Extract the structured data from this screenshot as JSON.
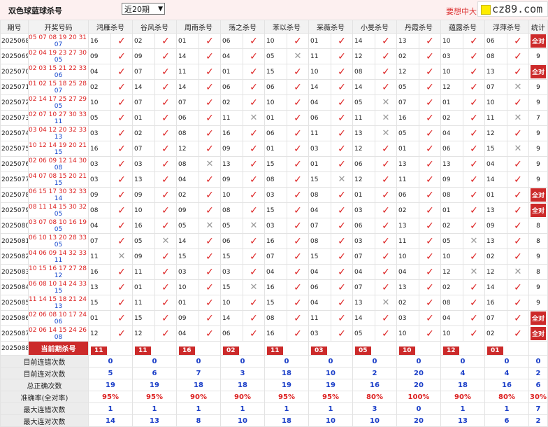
{
  "header": {
    "title": "双色球蓝球杀号",
    "range_select": "近20期",
    "promo": "要想中大",
    "logo": "cz89.com"
  },
  "columns": [
    "期号",
    "开奖号码",
    "鸿雁杀号",
    "谷风杀号",
    "周南杀号",
    "荡之杀号",
    "苯以杀号",
    "采薇杀号",
    "小旻杀号",
    "丹霞杀号",
    "蕴露杀号",
    "浮萍杀号",
    "统计"
  ],
  "rows": [
    {
      "p": "2025068",
      "red": "05 07 08 19 20 31 +",
      "blue": "07",
      "k": [
        [
          "16",
          1
        ],
        [
          "02",
          1
        ],
        [
          "01",
          1
        ],
        [
          "06",
          1
        ],
        [
          "10",
          1
        ],
        [
          "01",
          1
        ],
        [
          "14",
          1
        ],
        [
          "13",
          1
        ],
        [
          "10",
          1
        ],
        [
          "06",
          1
        ]
      ],
      "s": "全对"
    },
    {
      "p": "2025069",
      "red": "02 04 19 23 27 30 +",
      "blue": "05",
      "k": [
        [
          "09",
          1
        ],
        [
          "09",
          1
        ],
        [
          "14",
          1
        ],
        [
          "04",
          1
        ],
        [
          "05",
          0
        ],
        [
          "11",
          1
        ],
        [
          "12",
          1
        ],
        [
          "02",
          1
        ],
        [
          "03",
          1
        ],
        [
          "08",
          1
        ]
      ],
      "s": "9"
    },
    {
      "p": "2025070",
      "red": "02 03 15 21 22 33 +",
      "blue": "06",
      "k": [
        [
          "04",
          1
        ],
        [
          "07",
          1
        ],
        [
          "11",
          1
        ],
        [
          "01",
          1
        ],
        [
          "15",
          1
        ],
        [
          "10",
          1
        ],
        [
          "08",
          1
        ],
        [
          "12",
          1
        ],
        [
          "10",
          1
        ],
        [
          "13",
          1
        ]
      ],
      "s": "全对"
    },
    {
      "p": "2025071",
      "red": "01 02 15 18 25 28 +",
      "blue": "07",
      "k": [
        [
          "02",
          1
        ],
        [
          "14",
          1
        ],
        [
          "14",
          1
        ],
        [
          "06",
          1
        ],
        [
          "06",
          1
        ],
        [
          "14",
          1
        ],
        [
          "14",
          1
        ],
        [
          "05",
          1
        ],
        [
          "12",
          1
        ],
        [
          "07",
          0
        ]
      ],
      "s": "9"
    },
    {
      "p": "2025072",
      "red": "02 14 17 25 27 29 +",
      "blue": "05",
      "k": [
        [
          "10",
          1
        ],
        [
          "07",
          1
        ],
        [
          "07",
          1
        ],
        [
          "02",
          1
        ],
        [
          "10",
          1
        ],
        [
          "04",
          1
        ],
        [
          "05",
          0
        ],
        [
          "07",
          1
        ],
        [
          "01",
          1
        ],
        [
          "10",
          1
        ]
      ],
      "s": "9"
    },
    {
      "p": "2025073",
      "red": "02 07 10 27 30 33 +",
      "blue": "11",
      "k": [
        [
          "05",
          1
        ],
        [
          "01",
          1
        ],
        [
          "06",
          1
        ],
        [
          "11",
          0
        ],
        [
          "01",
          1
        ],
        [
          "06",
          1
        ],
        [
          "11",
          0
        ],
        [
          "16",
          1
        ],
        [
          "02",
          1
        ],
        [
          "11",
          0
        ]
      ],
      "s": "7"
    },
    {
      "p": "2025074",
      "red": "03 04 12 20 32 33 +",
      "blue": "13",
      "k": [
        [
          "03",
          1
        ],
        [
          "02",
          1
        ],
        [
          "08",
          1
        ],
        [
          "16",
          1
        ],
        [
          "06",
          1
        ],
        [
          "11",
          1
        ],
        [
          "13",
          0
        ],
        [
          "05",
          1
        ],
        [
          "04",
          1
        ],
        [
          "12",
          1
        ]
      ],
      "s": "9"
    },
    {
      "p": "2025075",
      "red": "10 12 14 19 20 21 +",
      "blue": "15",
      "k": [
        [
          "16",
          1
        ],
        [
          "07",
          1
        ],
        [
          "12",
          1
        ],
        [
          "09",
          1
        ],
        [
          "01",
          1
        ],
        [
          "03",
          1
        ],
        [
          "12",
          1
        ],
        [
          "01",
          1
        ],
        [
          "06",
          1
        ],
        [
          "15",
          0
        ]
      ],
      "s": "9"
    },
    {
      "p": "2025076",
      "red": "02 06 09 12 14 30 +",
      "blue": "08",
      "k": [
        [
          "03",
          1
        ],
        [
          "03",
          1
        ],
        [
          "08",
          0
        ],
        [
          "13",
          1
        ],
        [
          "15",
          1
        ],
        [
          "01",
          1
        ],
        [
          "06",
          1
        ],
        [
          "13",
          1
        ],
        [
          "13",
          1
        ],
        [
          "04",
          1
        ]
      ],
      "s": "9"
    },
    {
      "p": "2025077",
      "red": "04 07 08 15 20 21 +",
      "blue": "15",
      "k": [
        [
          "03",
          1
        ],
        [
          "13",
          1
        ],
        [
          "04",
          1
        ],
        [
          "09",
          1
        ],
        [
          "08",
          1
        ],
        [
          "15",
          0
        ],
        [
          "12",
          1
        ],
        [
          "11",
          1
        ],
        [
          "09",
          1
        ],
        [
          "14",
          1
        ]
      ],
      "s": "9"
    },
    {
      "p": "2025078",
      "red": "06 15 17 30 32 33 +",
      "blue": "14",
      "k": [
        [
          "09",
          1
        ],
        [
          "09",
          1
        ],
        [
          "02",
          1
        ],
        [
          "10",
          1
        ],
        [
          "03",
          1
        ],
        [
          "08",
          1
        ],
        [
          "01",
          1
        ],
        [
          "06",
          1
        ],
        [
          "08",
          1
        ],
        [
          "01",
          1
        ]
      ],
      "s": "全对"
    },
    {
      "p": "2025079",
      "red": "08 11 14 15 30 32 +",
      "blue": "05",
      "k": [
        [
          "08",
          1
        ],
        [
          "10",
          1
        ],
        [
          "09",
          1
        ],
        [
          "08",
          1
        ],
        [
          "15",
          1
        ],
        [
          "04",
          1
        ],
        [
          "03",
          1
        ],
        [
          "02",
          1
        ],
        [
          "01",
          1
        ],
        [
          "13",
          1
        ]
      ],
      "s": "全对"
    },
    {
      "p": "2025080",
      "red": "03 07 08 10 16 19 +",
      "blue": "05",
      "k": [
        [
          "04",
          1
        ],
        [
          "16",
          1
        ],
        [
          "05",
          0
        ],
        [
          "05",
          0
        ],
        [
          "03",
          1
        ],
        [
          "07",
          1
        ],
        [
          "06",
          1
        ],
        [
          "13",
          1
        ],
        [
          "02",
          1
        ],
        [
          "09",
          1
        ]
      ],
      "s": "8"
    },
    {
      "p": "2025081",
      "red": "06 10 13 20 28 33 +",
      "blue": "05",
      "k": [
        [
          "07",
          1
        ],
        [
          "05",
          0
        ],
        [
          "14",
          1
        ],
        [
          "06",
          1
        ],
        [
          "16",
          1
        ],
        [
          "08",
          1
        ],
        [
          "03",
          1
        ],
        [
          "11",
          1
        ],
        [
          "05",
          0
        ],
        [
          "13",
          1
        ]
      ],
      "s": "8"
    },
    {
      "p": "2025082",
      "red": "04 06 09 14 32 33 +",
      "blue": "11",
      "k": [
        [
          "11",
          0
        ],
        [
          "09",
          1
        ],
        [
          "15",
          1
        ],
        [
          "15",
          1
        ],
        [
          "07",
          1
        ],
        [
          "15",
          1
        ],
        [
          "07",
          1
        ],
        [
          "10",
          1
        ],
        [
          "10",
          1
        ],
        [
          "02",
          1
        ]
      ],
      "s": "9"
    },
    {
      "p": "2025083",
      "red": "10 15 16 17 27 28 +",
      "blue": "12",
      "k": [
        [
          "16",
          1
        ],
        [
          "11",
          1
        ],
        [
          "03",
          1
        ],
        [
          "03",
          1
        ],
        [
          "04",
          1
        ],
        [
          "04",
          1
        ],
        [
          "04",
          1
        ],
        [
          "04",
          1
        ],
        [
          "12",
          0
        ],
        [
          "12",
          0
        ]
      ],
      "s": "8"
    },
    {
      "p": "2025084",
      "red": "06 08 10 14 24 33 +",
      "blue": "15",
      "k": [
        [
          "13",
          1
        ],
        [
          "01",
          1
        ],
        [
          "10",
          1
        ],
        [
          "15",
          0
        ],
        [
          "16",
          1
        ],
        [
          "06",
          1
        ],
        [
          "07",
          1
        ],
        [
          "13",
          1
        ],
        [
          "02",
          1
        ],
        [
          "14",
          1
        ]
      ],
      "s": "9"
    },
    {
      "p": "2025085",
      "red": "11 14 15 18 21 24 +",
      "blue": "13",
      "k": [
        [
          "15",
          1
        ],
        [
          "11",
          1
        ],
        [
          "01",
          1
        ],
        [
          "10",
          1
        ],
        [
          "15",
          1
        ],
        [
          "04",
          1
        ],
        [
          "13",
          0
        ],
        [
          "02",
          1
        ],
        [
          "08",
          1
        ],
        [
          "16",
          1
        ]
      ],
      "s": "9"
    },
    {
      "p": "2025086",
      "red": "02 06 08 10 17 24 +",
      "blue": "06",
      "k": [
        [
          "01",
          1
        ],
        [
          "15",
          1
        ],
        [
          "09",
          1
        ],
        [
          "14",
          1
        ],
        [
          "08",
          1
        ],
        [
          "11",
          1
        ],
        [
          "14",
          1
        ],
        [
          "03",
          1
        ],
        [
          "04",
          1
        ],
        [
          "07",
          1
        ]
      ],
      "s": "全对"
    },
    {
      "p": "2025087",
      "red": "02 06 14 15 24 26 +",
      "blue": "08",
      "k": [
        [
          "12",
          1
        ],
        [
          "12",
          1
        ],
        [
          "04",
          1
        ],
        [
          "06",
          1
        ],
        [
          "16",
          1
        ],
        [
          "03",
          1
        ],
        [
          "05",
          1
        ],
        [
          "10",
          1
        ],
        [
          "10",
          1
        ],
        [
          "02",
          1
        ]
      ],
      "s": "全对"
    }
  ],
  "current": {
    "p": "2025088",
    "label": "当前期杀号",
    "k": [
      "11",
      "11",
      "16",
      "02",
      "11",
      "03",
      "05",
      "10",
      "12",
      "01"
    ]
  },
  "stats": [
    {
      "label": "目前连错次数",
      "v": [
        "0",
        "0",
        "0",
        "0",
        "0",
        "0",
        "0",
        "0",
        "0",
        "0",
        "0"
      ]
    },
    {
      "label": "目前连对次数",
      "v": [
        "5",
        "6",
        "7",
        "3",
        "18",
        "10",
        "2",
        "20",
        "4",
        "4",
        "2"
      ]
    },
    {
      "label": "总正确次数",
      "v": [
        "19",
        "19",
        "18",
        "18",
        "19",
        "19",
        "16",
        "20",
        "18",
        "16",
        "6"
      ]
    },
    {
      "label": "准确率(全对率)",
      "v": [
        "95%",
        "95%",
        "90%",
        "90%",
        "95%",
        "95%",
        "80%",
        "100%",
        "90%",
        "80%",
        "30%"
      ],
      "pct": true
    },
    {
      "label": "最大连错次数",
      "v": [
        "1",
        "1",
        "1",
        "1",
        "1",
        "1",
        "3",
        "0",
        "1",
        "1",
        "7"
      ]
    },
    {
      "label": "最大连对次数",
      "v": [
        "14",
        "13",
        "8",
        "10",
        "18",
        "10",
        "10",
        "20",
        "13",
        "6",
        "2"
      ]
    }
  ],
  "colors": {
    "accent": "#cc2a2a",
    "blue": "#1a3ec8",
    "red": "#dd2222"
  }
}
